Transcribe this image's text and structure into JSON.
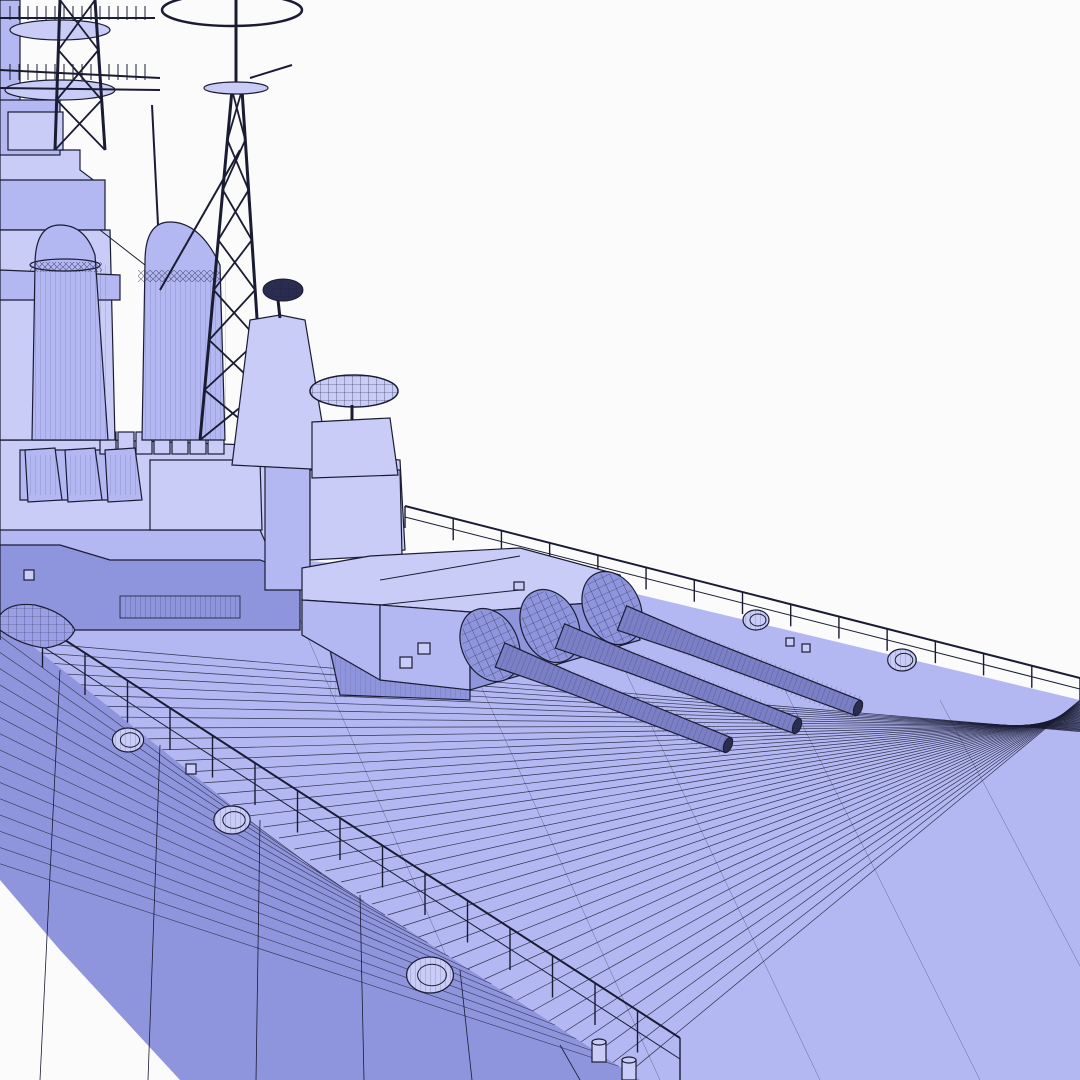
{
  "viewport": {
    "background": "#fbfbfb",
    "shading": "wireframe-on-shaded"
  },
  "model": {
    "subject": "battleship",
    "fill_color": "#b3b8f2",
    "fill_light": "#c9ccf7",
    "fill_dark": "#8f95dc",
    "wire_color": "#1a1c33",
    "visible_parts": [
      "deck-plank-mesh",
      "hull-side-mesh",
      "deck-railing",
      "triple-gun-turret",
      "gun-barrel-1",
      "gun-barrel-2",
      "gun-barrel-3",
      "funnel-forward",
      "funnel-aft",
      "lattice-mast",
      "bridge-superstructure",
      "radar-dish",
      "searchlight",
      "bollards",
      "anchor-fairleads",
      "boat"
    ]
  }
}
